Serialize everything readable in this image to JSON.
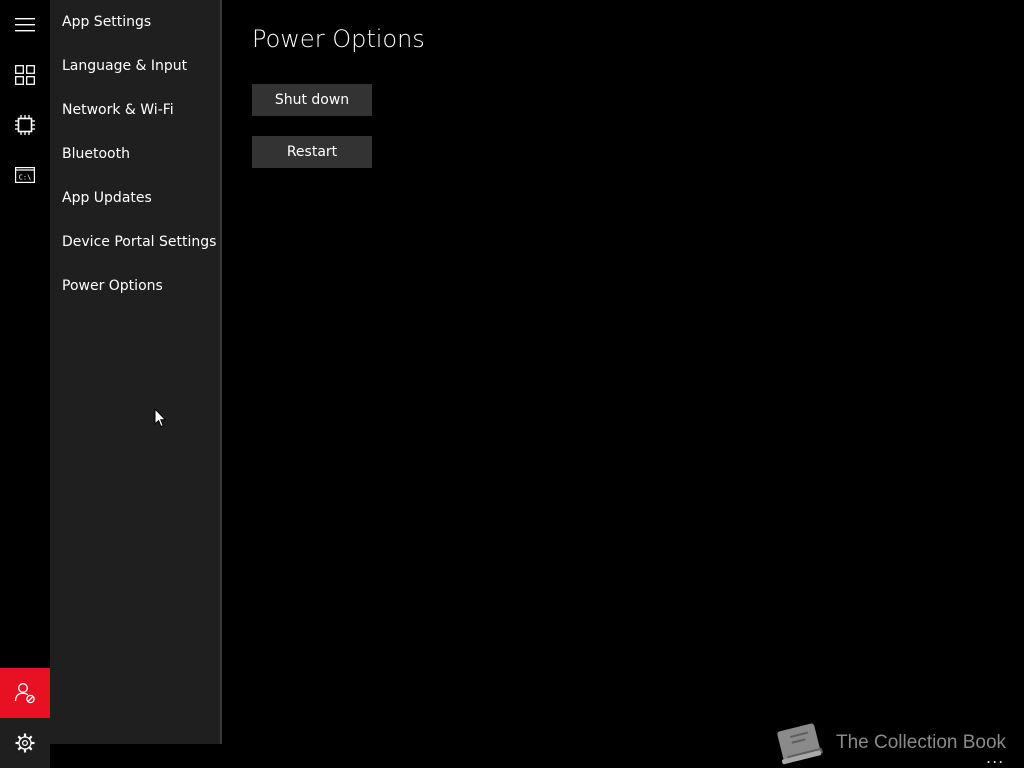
{
  "nav_rail": {
    "items": [
      {
        "icon": "hamburger-menu-icon"
      },
      {
        "icon": "apps-grid-icon"
      },
      {
        "icon": "processor-chip-icon"
      },
      {
        "icon": "command-prompt-icon",
        "glyph": "C:\\"
      }
    ],
    "user_icon": "user-blocked-icon",
    "settings_icon": "gear-icon"
  },
  "settings_pane": {
    "items": [
      {
        "label": "App Settings"
      },
      {
        "label": "Language & Input"
      },
      {
        "label": "Network & Wi-Fi"
      },
      {
        "label": "Bluetooth"
      },
      {
        "label": "App Updates"
      },
      {
        "label": "Device Portal Settings"
      },
      {
        "label": "Power Options"
      }
    ],
    "selected": "Power Options"
  },
  "main": {
    "title": "Power Options",
    "shutdown_label": "Shut down",
    "restart_label": "Restart"
  },
  "watermark": {
    "text": "The Collection Book",
    "icon": "book-icon"
  },
  "more_label": "...",
  "colors": {
    "background": "#000000",
    "pane": "#1f1f1f",
    "button": "#333333",
    "user_accent": "#e81123",
    "watermark": "#8a8a8a"
  }
}
